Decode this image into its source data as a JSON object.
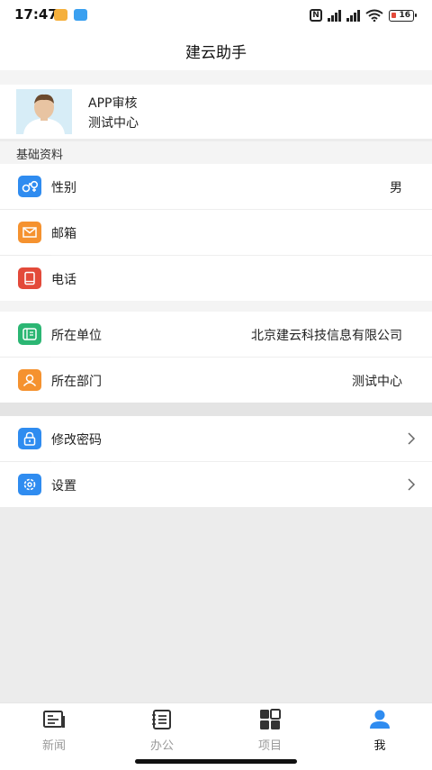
{
  "status": {
    "time": "17:47",
    "battery": "16"
  },
  "nav": {
    "title": "建云助手"
  },
  "profile": {
    "name": "APP审核",
    "dept": "测试中心"
  },
  "section": {
    "basic_label": "基础资料"
  },
  "rows": {
    "gender": {
      "label": "性别",
      "value": "男"
    },
    "email": {
      "label": "邮箱",
      "value": ""
    },
    "phone": {
      "label": "电话",
      "value": ""
    },
    "company": {
      "label": "所在单位",
      "value": "北京建云科技信息有限公司"
    },
    "department": {
      "label": "所在部门",
      "value": "测试中心"
    },
    "password": {
      "label": "修改密码"
    },
    "settings": {
      "label": "设置"
    }
  },
  "tabs": [
    {
      "label": "新闻",
      "icon": "news-icon"
    },
    {
      "label": "办公",
      "icon": "office-icon"
    },
    {
      "label": "项目",
      "icon": "project-grid-icon"
    },
    {
      "label": "我",
      "icon": "person-icon"
    }
  ],
  "colors": {
    "blue": "#2f8cf0",
    "orange": "#f5922f",
    "red": "#e34a3a",
    "green": "#2bb673",
    "tab_active": "#2f8cf0"
  }
}
